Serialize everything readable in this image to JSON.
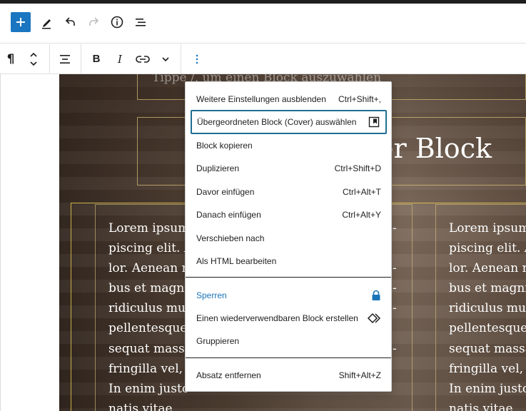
{
  "header": {
    "add_block": "add-block",
    "tools": "pen-icon",
    "undo": "undo-icon",
    "redo": "redo-icon",
    "details": "info-icon",
    "list_view": "list-view-icon"
  },
  "block_toolbar": {
    "icons": [
      "paragraph-icon",
      "move-up-down-icon",
      "align-icon",
      "bold-icon",
      "italic-icon",
      "link-icon",
      "chevron-down-icon",
      "kebab-icon"
    ],
    "bold_label": "B",
    "italic_label": "I"
  },
  "canvas": {
    "hint_text": "Tippe /, um einen Block auszuwählen",
    "heading_fragment": "er Block",
    "column1_lines": "Lorem ipsum\npiscing elit. A\nlor. Aenean r\nbus et magn\nridiculus mu\npellentesque\nsequat mass\nfringilla vel, a\nIn enim justo\nnatis vitae",
    "column1_right": "-\n \n-\n-\n-\n \n-\n \n \n ",
    "column2_lines": "Lorem ipsum\npiscing elit. A\nlor. Aenean n\nbus et magni\nridiculus mu\npellentesque\nsequat massa\nfringilla vel, a\nIn enim justo\nnatis vitae"
  },
  "menu": {
    "items": [
      {
        "label": "Weitere Einstellungen ausblenden",
        "shortcut": "Ctrl+Shift+,"
      },
      {
        "label": "Übergeordneten Block (Cover) auswählen",
        "shortcut": ""
      },
      {
        "label": "Block kopieren",
        "shortcut": ""
      },
      {
        "label": "Duplizieren",
        "shortcut": "Ctrl+Shift+D"
      },
      {
        "label": "Davor einfügen",
        "shortcut": "Ctrl+Alt+T"
      },
      {
        "label": "Danach einfügen",
        "shortcut": "Ctrl+Alt+Y"
      },
      {
        "label": "Verschieben nach",
        "shortcut": ""
      },
      {
        "label": "Als HTML bearbeiten",
        "shortcut": ""
      },
      {
        "label": "Sperren",
        "shortcut": ""
      },
      {
        "label": "Einen wiederverwendbaren Block erstellen",
        "shortcut": ""
      },
      {
        "label": "Gruppieren",
        "shortcut": ""
      },
      {
        "label": "Absatz entfernen",
        "shortcut": "Shift+Alt+Z"
      }
    ]
  },
  "colors": {
    "accent": "#1b76c1",
    "lock_blue": "#1a74b8",
    "focus_border": "#1f6f93"
  }
}
